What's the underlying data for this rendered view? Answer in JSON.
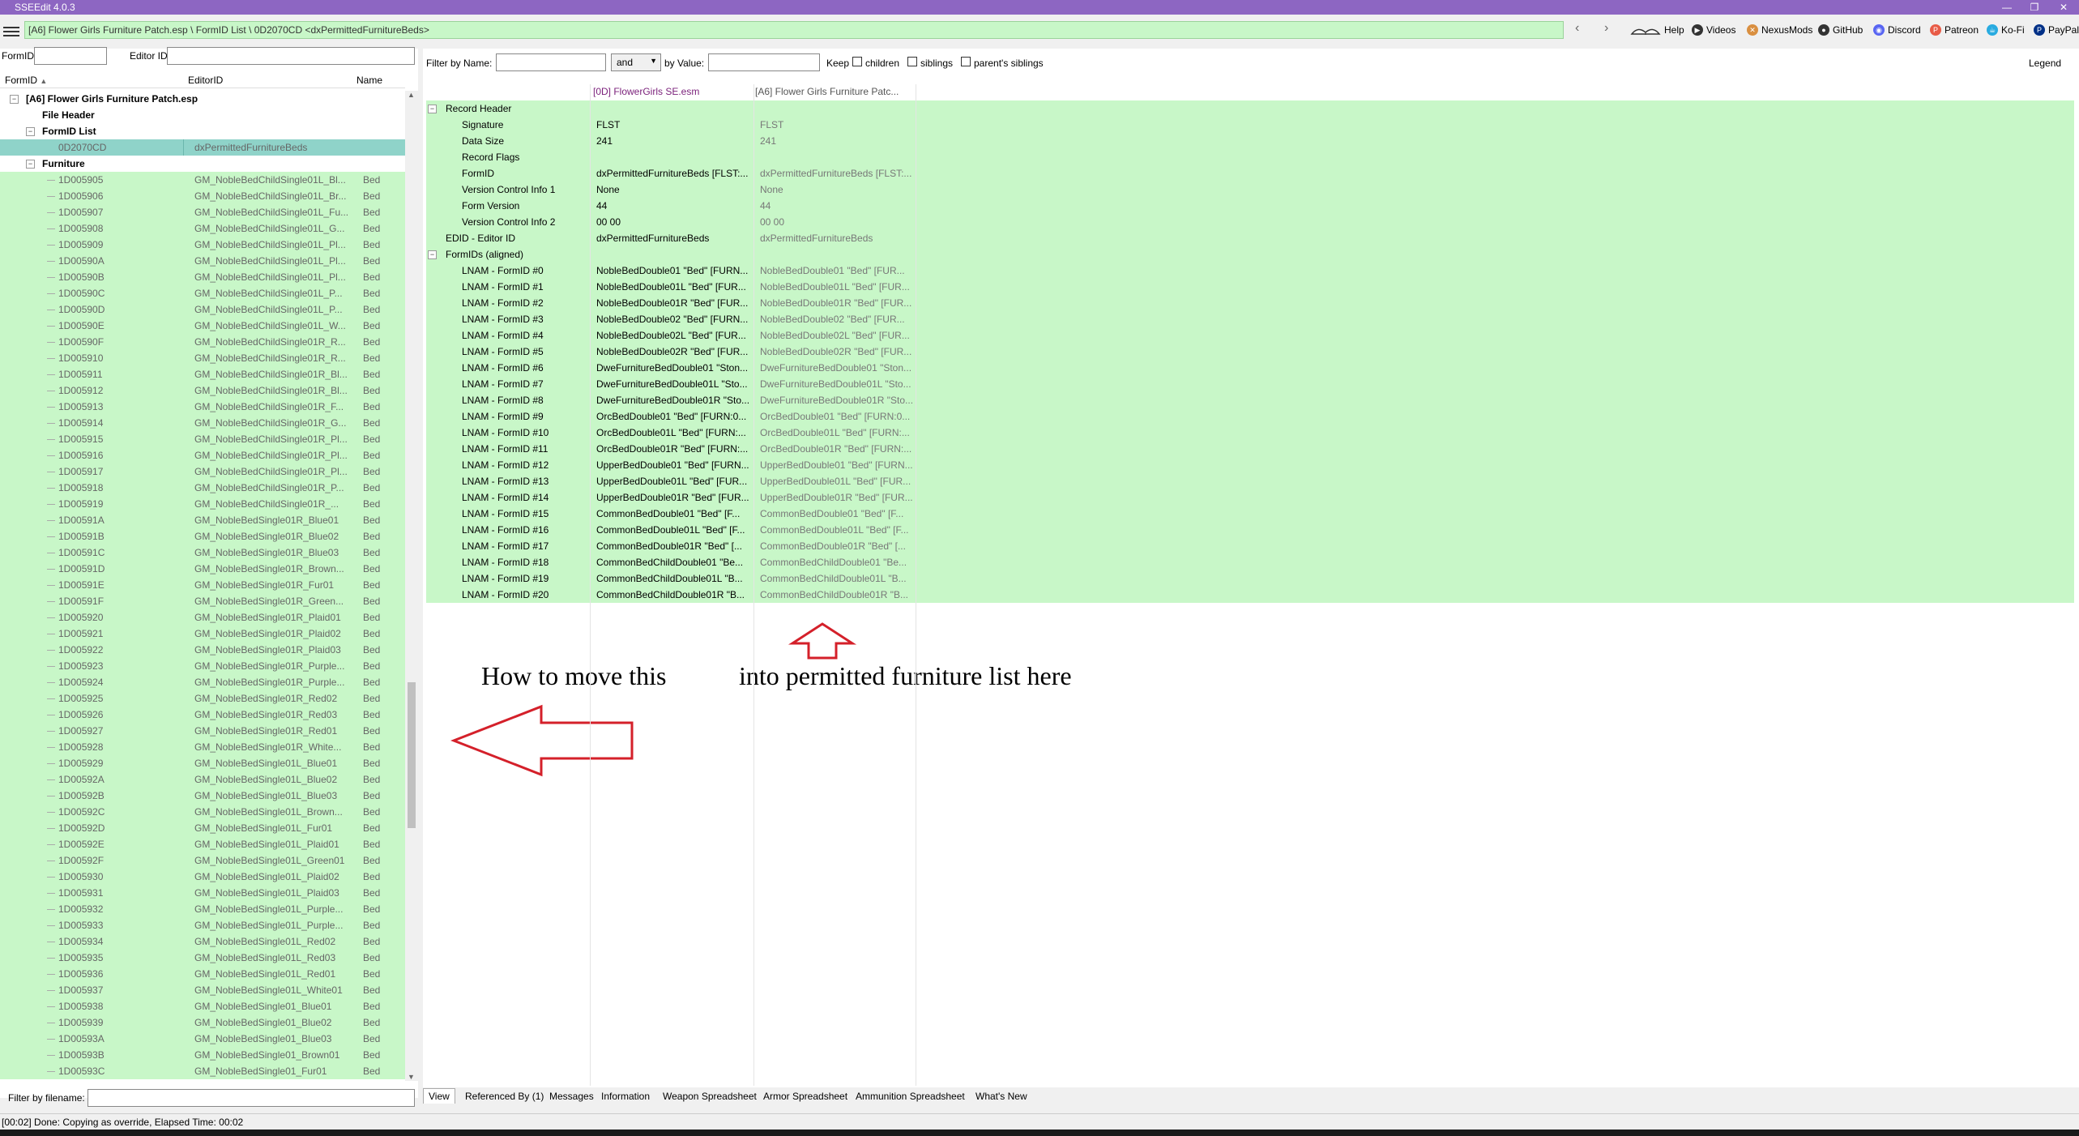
{
  "window": {
    "title": "SSEEdit 4.0.3",
    "path": "[A6] Flower Girls Furniture Patch.esp \\ FormID List \\ 0D2070CD <dxPermittedFurnitureBeds>"
  },
  "toolbar": {
    "links": [
      "Help",
      "Videos",
      "NexusMods",
      "GitHub",
      "Discord",
      "Patreon",
      "Ko-Fi",
      "PayPal"
    ]
  },
  "left": {
    "formid_label": "FormID",
    "editorid_label": "Editor ID",
    "col_formid": "FormID",
    "col_editorid": "EditorID",
    "col_name": "Name",
    "plugin": "[A6] Flower Girls Furniture Patch.esp",
    "file_header": "File Header",
    "formid_list": "FormID List",
    "selected_formid": "0D2070CD",
    "selected_editorid": "dxPermittedFurnitureBeds",
    "furniture": "Furniture",
    "rows": [
      [
        "1D005905",
        "GM_NobleBedChildSingle01L_Bl...",
        "Bed"
      ],
      [
        "1D005906",
        "GM_NobleBedChildSingle01L_Br...",
        "Bed"
      ],
      [
        "1D005907",
        "GM_NobleBedChildSingle01L_Fu...",
        "Bed"
      ],
      [
        "1D005908",
        "GM_NobleBedChildSingle01L_G...",
        "Bed"
      ],
      [
        "1D005909",
        "GM_NobleBedChildSingle01L_Pl...",
        "Bed"
      ],
      [
        "1D00590A",
        "GM_NobleBedChildSingle01L_Pl...",
        "Bed"
      ],
      [
        "1D00590B",
        "GM_NobleBedChildSingle01L_Pl...",
        "Bed"
      ],
      [
        "1D00590C",
        "GM_NobleBedChildSingle01L_P...",
        "Bed"
      ],
      [
        "1D00590D",
        "GM_NobleBedChildSingle01L_P...",
        "Bed"
      ],
      [
        "1D00590E",
        "GM_NobleBedChildSingle01L_W...",
        "Bed"
      ],
      [
        "1D00590F",
        "GM_NobleBedChildSingle01R_R...",
        "Bed"
      ],
      [
        "1D005910",
        "GM_NobleBedChildSingle01R_R...",
        "Bed"
      ],
      [
        "1D005911",
        "GM_NobleBedChildSingle01R_Bl...",
        "Bed"
      ],
      [
        "1D005912",
        "GM_NobleBedChildSingle01R_Bl...",
        "Bed"
      ],
      [
        "1D005913",
        "GM_NobleBedChildSingle01R_F...",
        "Bed"
      ],
      [
        "1D005914",
        "GM_NobleBedChildSingle01R_G...",
        "Bed"
      ],
      [
        "1D005915",
        "GM_NobleBedChildSingle01R_Pl...",
        "Bed"
      ],
      [
        "1D005916",
        "GM_NobleBedChildSingle01R_Pl...",
        "Bed"
      ],
      [
        "1D005917",
        "GM_NobleBedChildSingle01R_Pl...",
        "Bed"
      ],
      [
        "1D005918",
        "GM_NobleBedChildSingle01R_P...",
        "Bed"
      ],
      [
        "1D005919",
        "GM_NobleBedChildSingle01R_...",
        "Bed"
      ],
      [
        "1D00591A",
        "GM_NobleBedSingle01R_Blue01",
        "Bed"
      ],
      [
        "1D00591B",
        "GM_NobleBedSingle01R_Blue02",
        "Bed"
      ],
      [
        "1D00591C",
        "GM_NobleBedSingle01R_Blue03",
        "Bed"
      ],
      [
        "1D00591D",
        "GM_NobleBedSingle01R_Brown...",
        "Bed"
      ],
      [
        "1D00591E",
        "GM_NobleBedSingle01R_Fur01",
        "Bed"
      ],
      [
        "1D00591F",
        "GM_NobleBedSingle01R_Green...",
        "Bed"
      ],
      [
        "1D005920",
        "GM_NobleBedSingle01R_Plaid01",
        "Bed"
      ],
      [
        "1D005921",
        "GM_NobleBedSingle01R_Plaid02",
        "Bed"
      ],
      [
        "1D005922",
        "GM_NobleBedSingle01R_Plaid03",
        "Bed"
      ],
      [
        "1D005923",
        "GM_NobleBedSingle01R_Purple...",
        "Bed"
      ],
      [
        "1D005924",
        "GM_NobleBedSingle01R_Purple...",
        "Bed"
      ],
      [
        "1D005925",
        "GM_NobleBedSingle01R_Red02",
        "Bed"
      ],
      [
        "1D005926",
        "GM_NobleBedSingle01R_Red03",
        "Bed"
      ],
      [
        "1D005927",
        "GM_NobleBedSingle01R_Red01",
        "Bed"
      ],
      [
        "1D005928",
        "GM_NobleBedSingle01R_White...",
        "Bed"
      ],
      [
        "1D005929",
        "GM_NobleBedSingle01L_Blue01",
        "Bed"
      ],
      [
        "1D00592A",
        "GM_NobleBedSingle01L_Blue02",
        "Bed"
      ],
      [
        "1D00592B",
        "GM_NobleBedSingle01L_Blue03",
        "Bed"
      ],
      [
        "1D00592C",
        "GM_NobleBedSingle01L_Brown...",
        "Bed"
      ],
      [
        "1D00592D",
        "GM_NobleBedSingle01L_Fur01",
        "Bed"
      ],
      [
        "1D00592E",
        "GM_NobleBedSingle01L_Plaid01",
        "Bed"
      ],
      [
        "1D00592F",
        "GM_NobleBedSingle01L_Green01",
        "Bed"
      ],
      [
        "1D005930",
        "GM_NobleBedSingle01L_Plaid02",
        "Bed"
      ],
      [
        "1D005931",
        "GM_NobleBedSingle01L_Plaid03",
        "Bed"
      ],
      [
        "1D005932",
        "GM_NobleBedSingle01L_Purple...",
        "Bed"
      ],
      [
        "1D005933",
        "GM_NobleBedSingle01L_Purple...",
        "Bed"
      ],
      [
        "1D005934",
        "GM_NobleBedSingle01L_Red02",
        "Bed"
      ],
      [
        "1D005935",
        "GM_NobleBedSingle01L_Red03",
        "Bed"
      ],
      [
        "1D005936",
        "GM_NobleBedSingle01L_Red01",
        "Bed"
      ],
      [
        "1D005937",
        "GM_NobleBedSingle01L_White01",
        "Bed"
      ],
      [
        "1D005938",
        "GM_NobleBedSingle01_Blue01",
        "Bed"
      ],
      [
        "1D005939",
        "GM_NobleBedSingle01_Blue02",
        "Bed"
      ],
      [
        "1D00593A",
        "GM_NobleBedSingle01_Blue03",
        "Bed"
      ],
      [
        "1D00593B",
        "GM_NobleBedSingle01_Brown01",
        "Bed"
      ],
      [
        "1D00593C",
        "GM_NobleBedSingle01_Fur01",
        "Bed"
      ]
    ],
    "filter_filename_label": "Filter by filename:"
  },
  "filter": {
    "by_name": "Filter by Name:",
    "and": "and",
    "by_value": "by Value:",
    "keep": "Keep",
    "children": "children",
    "siblings": "siblings",
    "parents_siblings": "parent's siblings",
    "legend": "Legend"
  },
  "record": {
    "col1": "[0D] FlowerGirls SE.esm",
    "col2": "[A6] Flower Girls Furniture Patc...",
    "rows": [
      {
        "label": "Record Header",
        "v1": "",
        "v2": "",
        "indent": 1,
        "exp": "−"
      },
      {
        "label": "Signature",
        "v1": "FLST",
        "v2": "FLST",
        "indent": 2
      },
      {
        "label": "Data Size",
        "v1": "241",
        "v2": "241",
        "indent": 2
      },
      {
        "label": "Record Flags",
        "v1": "",
        "v2": "",
        "indent": 2
      },
      {
        "label": "FormID",
        "v1": "dxPermittedFurnitureBeds [FLST:...",
        "v2": "dxPermittedFurnitureBeds [FLST:...",
        "indent": 2
      },
      {
        "label": "Version Control Info 1",
        "v1": "None",
        "v2": "None",
        "indent": 2
      },
      {
        "label": "Form Version",
        "v1": "44",
        "v2": "44",
        "indent": 2
      },
      {
        "label": "Version Control Info 2",
        "v1": "00 00",
        "v2": "00 00",
        "indent": 2
      },
      {
        "label": "EDID - Editor ID",
        "v1": "dxPermittedFurnitureBeds",
        "v2": "dxPermittedFurnitureBeds",
        "indent": 1
      },
      {
        "label": "FormIDs (aligned)",
        "v1": "",
        "v2": "",
        "indent": 1,
        "exp": "−"
      },
      {
        "label": "LNAM - FormID #0",
        "v1": "NobleBedDouble01 \"Bed\" [FURN...",
        "v2": "NobleBedDouble01 \"Bed\" [FUR...",
        "indent": 2
      },
      {
        "label": "LNAM - FormID #1",
        "v1": "NobleBedDouble01L \"Bed\" [FUR...",
        "v2": "NobleBedDouble01L \"Bed\" [FUR...",
        "indent": 2
      },
      {
        "label": "LNAM - FormID #2",
        "v1": "NobleBedDouble01R \"Bed\" [FUR...",
        "v2": "NobleBedDouble01R \"Bed\" [FUR...",
        "indent": 2
      },
      {
        "label": "LNAM - FormID #3",
        "v1": "NobleBedDouble02 \"Bed\" [FURN...",
        "v2": "NobleBedDouble02 \"Bed\" [FUR...",
        "indent": 2
      },
      {
        "label": "LNAM - FormID #4",
        "v1": "NobleBedDouble02L \"Bed\" [FUR...",
        "v2": "NobleBedDouble02L \"Bed\" [FUR...",
        "indent": 2
      },
      {
        "label": "LNAM - FormID #5",
        "v1": "NobleBedDouble02R \"Bed\" [FUR...",
        "v2": "NobleBedDouble02R \"Bed\" [FUR...",
        "indent": 2
      },
      {
        "label": "LNAM - FormID #6",
        "v1": "DweFurnitureBedDouble01 \"Ston...",
        "v2": "DweFurnitureBedDouble01 \"Ston...",
        "indent": 2
      },
      {
        "label": "LNAM - FormID #7",
        "v1": "DweFurnitureBedDouble01L \"Sto...",
        "v2": "DweFurnitureBedDouble01L \"Sto...",
        "indent": 2
      },
      {
        "label": "LNAM - FormID #8",
        "v1": "DweFurnitureBedDouble01R \"Sto...",
        "v2": "DweFurnitureBedDouble01R \"Sto...",
        "indent": 2
      },
      {
        "label": "LNAM - FormID #9",
        "v1": "OrcBedDouble01 \"Bed\" [FURN:0...",
        "v2": "OrcBedDouble01 \"Bed\" [FURN:0...",
        "indent": 2
      },
      {
        "label": "LNAM - FormID #10",
        "v1": "OrcBedDouble01L \"Bed\" [FURN:...",
        "v2": "OrcBedDouble01L \"Bed\" [FURN:...",
        "indent": 2
      },
      {
        "label": "LNAM - FormID #11",
        "v1": "OrcBedDouble01R \"Bed\" [FURN:...",
        "v2": "OrcBedDouble01R \"Bed\" [FURN:...",
        "indent": 2
      },
      {
        "label": "LNAM - FormID #12",
        "v1": "UpperBedDouble01 \"Bed\" [FURN...",
        "v2": "UpperBedDouble01 \"Bed\" [FURN...",
        "indent": 2
      },
      {
        "label": "LNAM - FormID #13",
        "v1": "UpperBedDouble01L \"Bed\" [FUR...",
        "v2": "UpperBedDouble01L \"Bed\" [FUR...",
        "indent": 2
      },
      {
        "label": "LNAM - FormID #14",
        "v1": "UpperBedDouble01R \"Bed\" [FUR...",
        "v2": "UpperBedDouble01R \"Bed\" [FUR...",
        "indent": 2
      },
      {
        "label": "LNAM - FormID #15",
        "v1": "CommonBedDouble01 \"Bed\" [F...",
        "v2": "CommonBedDouble01 \"Bed\" [F...",
        "indent": 2
      },
      {
        "label": "LNAM - FormID #16",
        "v1": "CommonBedDouble01L \"Bed\" [F...",
        "v2": "CommonBedDouble01L \"Bed\" [F...",
        "indent": 2
      },
      {
        "label": "LNAM - FormID #17",
        "v1": "CommonBedDouble01R \"Bed\" [...",
        "v2": "CommonBedDouble01R \"Bed\" [...",
        "indent": 2
      },
      {
        "label": "LNAM - FormID #18",
        "v1": "CommonBedChildDouble01 \"Be...",
        "v2": "CommonBedChildDouble01 \"Be...",
        "indent": 2
      },
      {
        "label": "LNAM - FormID #19",
        "v1": "CommonBedChildDouble01L \"B...",
        "v2": "CommonBedChildDouble01L \"B...",
        "indent": 2
      },
      {
        "label": "LNAM - FormID #20",
        "v1": "CommonBedChildDouble01R \"B...",
        "v2": "CommonBedChildDouble01R \"B...",
        "indent": 2
      }
    ]
  },
  "annotation": {
    "left_text": "How to move this",
    "right_text": "into permitted furniture list here",
    "arrow_color": "#d4202a"
  },
  "tabs": [
    "View",
    "Referenced By (1)",
    "Messages",
    "Information",
    "Weapon Spreadsheet",
    "Armor Spreadsheet",
    "Ammunition Spreadsheet",
    "What's New"
  ],
  "status": "[00:02] Done: Copying as override, Elapsed Time: 00:02",
  "colors": {
    "titlebar": "#8d66c2",
    "row_green": "#c8f7c8",
    "row_selected": "#8fd3c9"
  }
}
